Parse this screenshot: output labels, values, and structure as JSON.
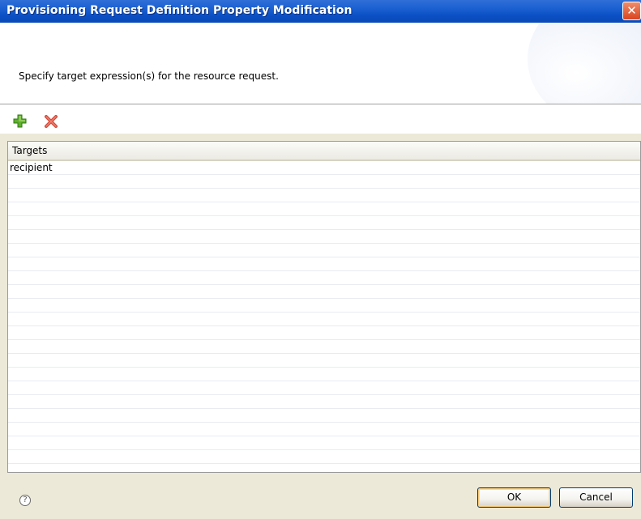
{
  "window": {
    "title": "Provisioning Request Definition Property Modification",
    "close_label": "✕"
  },
  "header": {
    "description": "Specify target expression(s) for the resource request."
  },
  "toolbar": {
    "add_icon": "add-icon",
    "remove_icon": "remove-icon"
  },
  "table": {
    "column_header": "Targets",
    "rows": [
      "recipient",
      "",
      "",
      "",
      "",
      "",
      "",
      "",
      "",
      "",
      "",
      "",
      "",
      "",
      "",
      "",
      "",
      "",
      "",
      "",
      "",
      "",
      ""
    ]
  },
  "footer": {
    "help_label": "?",
    "ok_label": "OK",
    "cancel_label": "Cancel"
  }
}
